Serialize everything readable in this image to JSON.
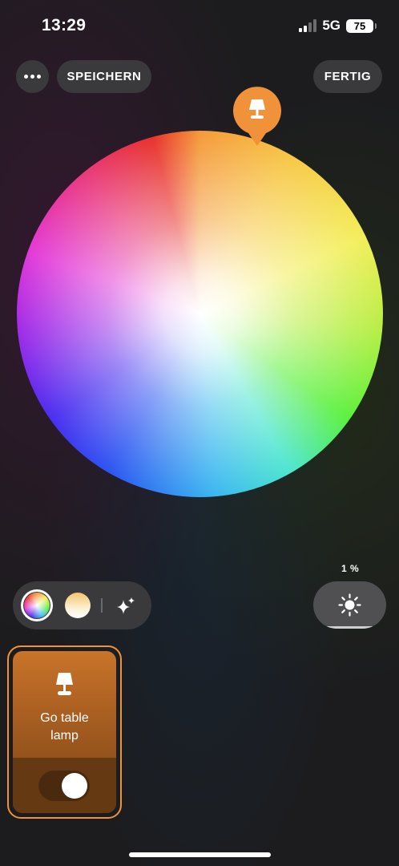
{
  "status_bar": {
    "time": "13:29",
    "network": "5G",
    "battery": "75",
    "signal_bars_active": 2,
    "signal_bars_total": 4
  },
  "toolbar": {
    "more_icon": "ellipsis-icon",
    "save_label": "SPEICHERN",
    "done_label": "FERTIG"
  },
  "color_wheel": {
    "marker_icon": "table-lamp-icon",
    "marker_color": "#f0923a"
  },
  "modes": {
    "color_icon": "color-wheel-icon",
    "white_icon": "white-ambiance-icon",
    "effects_icon": "sparkles-icon",
    "selected": "color"
  },
  "brightness": {
    "value_label": "1 %",
    "level": 0.01,
    "icon": "sun-icon"
  },
  "light": {
    "name_line1": "Go table",
    "name_line2": "lamp",
    "icon": "table-lamp-icon",
    "on": true,
    "accent_color": "#f0923a"
  }
}
